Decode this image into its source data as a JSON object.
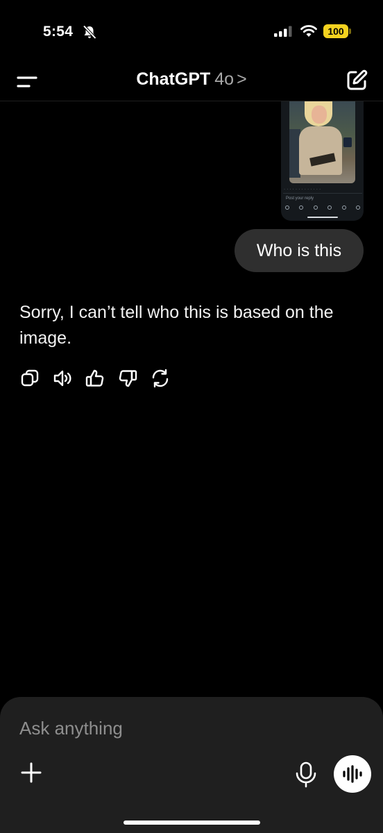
{
  "status_bar": {
    "time": "5:54",
    "battery": "100",
    "icons": [
      "bell-slash-icon",
      "signal-icon",
      "wifi-icon",
      "battery-icon"
    ],
    "battery_color": "#f4d21f"
  },
  "header": {
    "title": "ChatGPT",
    "model": "4o",
    "chevron": ">",
    "icons": [
      "menu-icon",
      "new-chat-icon"
    ]
  },
  "attachment": {
    "reply_placeholder": "Post your reply"
  },
  "messages": {
    "user": "Who is this",
    "assistant": "Sorry, I can’t tell who this is based on the image."
  },
  "actions": [
    "copy-icon",
    "read-aloud-icon",
    "thumbs-up-icon",
    "thumbs-down-icon",
    "regenerate-icon"
  ],
  "composer": {
    "placeholder": "Ask anything",
    "icons": [
      "plus-icon",
      "microphone-icon",
      "voice-mode-icon"
    ]
  },
  "colors": {
    "background": "#000000",
    "bubble": "#2f2f2f",
    "composer": "#1f1f1f",
    "muted_text": "#8e8e8e"
  }
}
